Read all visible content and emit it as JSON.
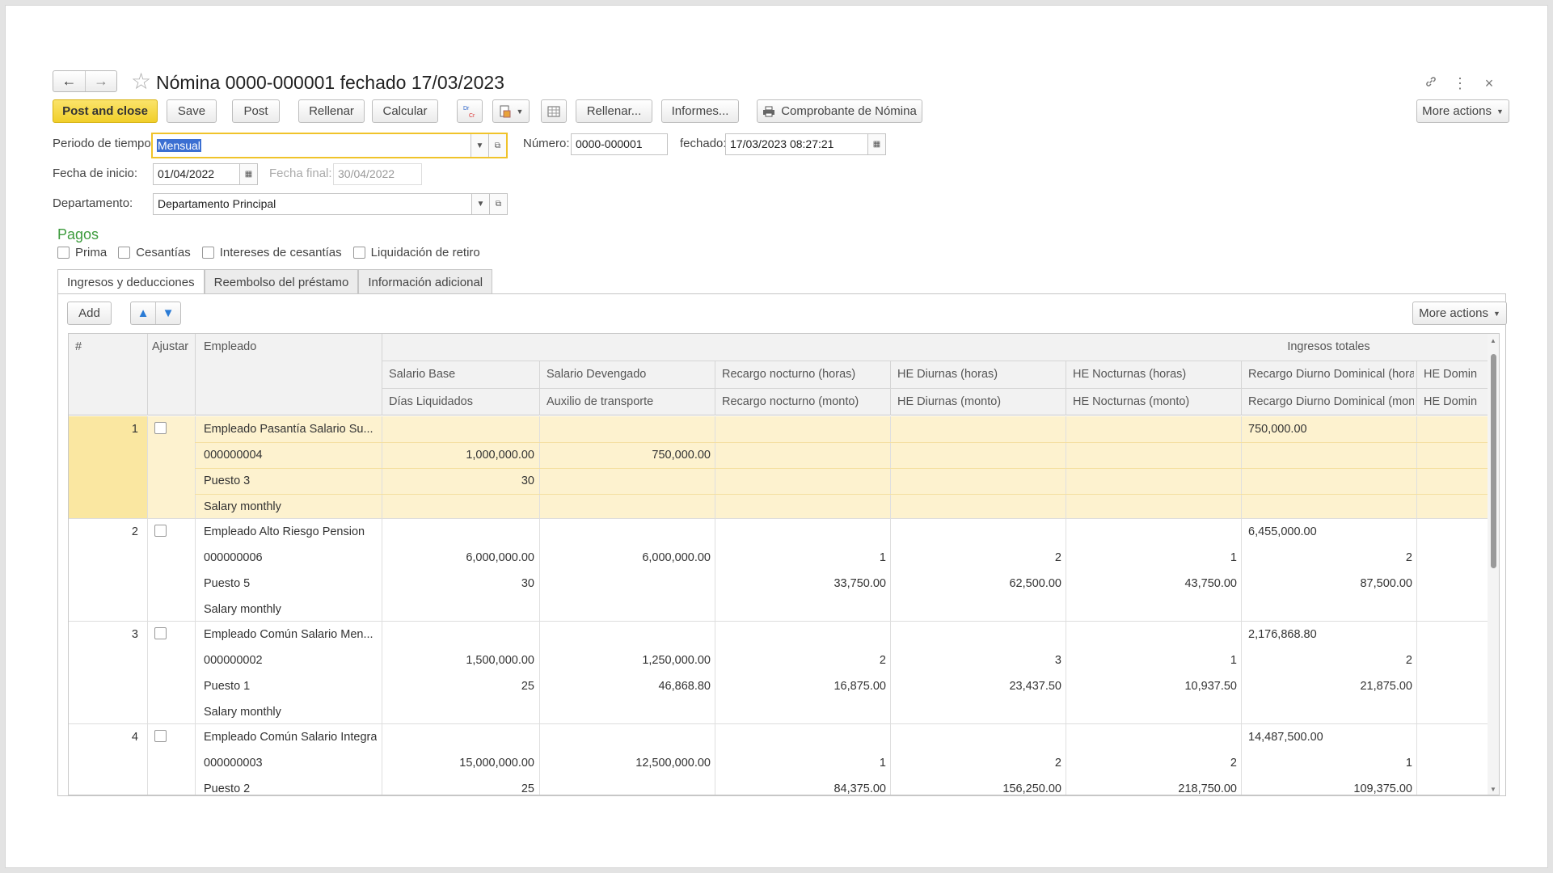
{
  "window": {
    "title": "Nómina 0000-000001 fechado 17/03/2023",
    "back_icon": "←",
    "forward_icon": "→",
    "star_icon": "☆",
    "link_icon": "🔗",
    "menu_icon": "⋮",
    "close_icon": "×"
  },
  "toolbar": {
    "post_and_close": "Post and close",
    "save": "Save",
    "post": "Post",
    "rellenar": "Rellenar",
    "calcular": "Calcular",
    "dr_cr": "Dr Cr",
    "rellenar_menu": "Rellenar...",
    "informes": "Informes...",
    "comprobante": "Comprobante de Nómina",
    "more_actions": "More actions"
  },
  "form": {
    "periodo_label": "Periodo de tiempo:",
    "periodo_value": "Mensual",
    "numero_label": "Número:",
    "numero_value": "0000-000001",
    "fechado_label": "fechado:",
    "fechado_value": "17/03/2023 08:27:21",
    "fecha_inicio_label": "Fecha de inicio:",
    "fecha_inicio_value": "01/04/2022",
    "fecha_final_label": "Fecha final:",
    "fecha_final_value": "30/04/2022",
    "departamento_label": "Departamento:",
    "departamento_value": "Departamento Principal"
  },
  "pagos": {
    "title": "Pagos",
    "options": [
      "Prima",
      "Cesantías",
      "Intereses de cesantías",
      "Liquidación de retiro"
    ]
  },
  "tabs": [
    "Ingresos y deducciones",
    "Reembolso del préstamo",
    "Información adicional"
  ],
  "table_toolbar": {
    "add": "Add",
    "up_icon": "🡅",
    "down_icon": "🡇",
    "more_actions": "More actions"
  },
  "table": {
    "headers": {
      "num": "#",
      "ajustar": "Ajustar",
      "empleado": "Empleado",
      "ingresos_totales": "Ingresos totales",
      "row2": [
        "Salario Base",
        "Salario Devengado",
        "Recargo nocturno (horas)",
        "HE Diurnas (horas)",
        "HE Nocturnas (horas)",
        "Recargo Diurno Dominical (horas)",
        "HE Domin"
      ],
      "row3": [
        "Días Liquidados",
        "Auxilio de transporte",
        "Recargo nocturno (monto)",
        "HE Diurnas (monto)",
        "HE Nocturnas (monto)",
        "Recargo Diurno Dominical (monto)",
        "HE Domin"
      ]
    },
    "rows": [
      {
        "num": "1",
        "name": "Empleado Pasantía Salario Su...",
        "code": "000000004",
        "position": "Puesto 3",
        "salary_type": "Salary monthly",
        "total": "750,000.00",
        "line2": [
          "1,000,000.00",
          "750,000.00",
          "",
          "",
          "",
          ""
        ],
        "line3": [
          "30",
          "",
          "",
          "",
          "",
          ""
        ]
      },
      {
        "num": "2",
        "name": "Empleado Alto Riesgo Pension",
        "code": "000000006",
        "position": "Puesto 5",
        "salary_type": "Salary monthly",
        "total": "6,455,000.00",
        "line2": [
          "6,000,000.00",
          "6,000,000.00",
          "1",
          "2",
          "1",
          "2"
        ],
        "line3": [
          "30",
          "",
          "33,750.00",
          "62,500.00",
          "43,750.00",
          "87,500.00"
        ]
      },
      {
        "num": "3",
        "name": "Empleado Común Salario Men...",
        "code": "000000002",
        "position": "Puesto 1",
        "salary_type": "Salary monthly",
        "total": "2,176,868.80",
        "line2": [
          "1,500,000.00",
          "1,250,000.00",
          "2",
          "3",
          "1",
          "2"
        ],
        "line3": [
          "25",
          "46,868.80",
          "16,875.00",
          "23,437.50",
          "10,937.50",
          "21,875.00"
        ]
      },
      {
        "num": "4",
        "name": "Empleado Común Salario Integral",
        "code": "000000003",
        "position": "Puesto 2",
        "salary_type": "",
        "total": "14,487,500.00",
        "line2": [
          "15,000,000.00",
          "12,500,000.00",
          "1",
          "2",
          "2",
          "1"
        ],
        "line3": [
          "25",
          "",
          "84,375.00",
          "156,250.00",
          "218,750.00",
          "109,375.00"
        ]
      }
    ]
  }
}
